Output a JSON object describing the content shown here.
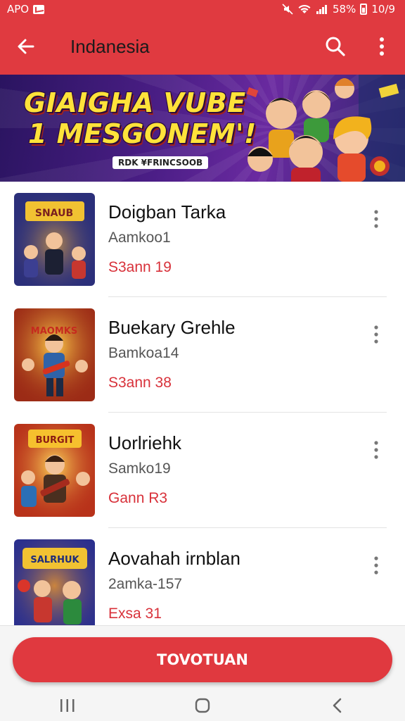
{
  "status_bar": {
    "left_text": "APO",
    "right_text": "58%",
    "time": "10/9"
  },
  "app_bar": {
    "title": "Indanesia"
  },
  "banner": {
    "headline_line1": "GIAIGHA VUBE",
    "headline_line2": "1 MESGONEM'!",
    "tag": "RDK ¥FRINCSOOB"
  },
  "games": [
    {
      "title": "Doigban Tarka",
      "subtitle": "Aamkoo1",
      "meta": "S3ann 19",
      "thumb_text": "SNAUB"
    },
    {
      "title": "Buekary Grehle",
      "subtitle": "Bamkoa14",
      "meta": "S3ann 38",
      "thumb_text": "MAOMKS"
    },
    {
      "title": "Uorlriehk",
      "subtitle": "Samko19",
      "meta": "Gann R3",
      "thumb_text": "BURGIT"
    },
    {
      "title": "Aovahah irnblan",
      "subtitle": "2amka-157",
      "meta": "Exsa 31",
      "thumb_text": "SALRHUK"
    }
  ],
  "primary_button": {
    "label": "TOVOTUAN"
  },
  "icons": {
    "back": "arrow-left-icon",
    "search": "search-icon",
    "more": "more-vert-icon",
    "nav_recent": "recent-apps-icon",
    "nav_home": "home-icon",
    "nav_back": "back-icon"
  },
  "colors": {
    "accent": "#e03a40",
    "meta_text": "#d8313a",
    "banner_text": "#ffe23a"
  }
}
